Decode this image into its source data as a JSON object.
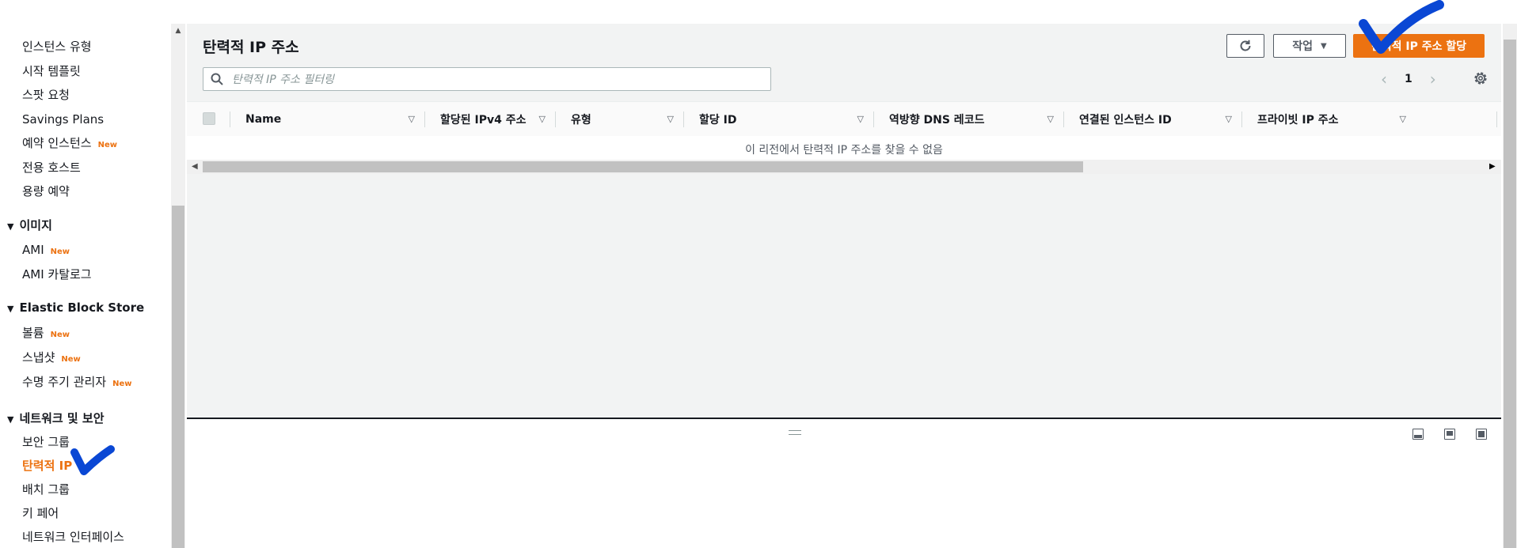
{
  "sidebar": {
    "items": [
      {
        "label": "인스턴스 유형"
      },
      {
        "label": "시작 템플릿"
      },
      {
        "label": "스팟 요청"
      },
      {
        "label": "Savings Plans"
      },
      {
        "label": "예약 인스턴스",
        "badge": "New"
      },
      {
        "label": "전용 호스트"
      },
      {
        "label": "용량 예약"
      }
    ],
    "sections": [
      {
        "title": "이미지",
        "items": [
          {
            "label": "AMI",
            "badge": "New"
          },
          {
            "label": "AMI 카탈로그"
          }
        ]
      },
      {
        "title": "Elastic Block Store",
        "items": [
          {
            "label": "볼륨",
            "badge": "New"
          },
          {
            "label": "스냅샷",
            "badge": "New"
          },
          {
            "label": "수명 주기 관리자",
            "badge": "New"
          }
        ]
      },
      {
        "title": "네트워크 및 보안",
        "items": [
          {
            "label": "보안 그룹"
          },
          {
            "label": "탄력적 IP",
            "active": true
          },
          {
            "label": "배치 그룹"
          },
          {
            "label": "키 페어"
          },
          {
            "label": "네트워크 인터페이스"
          }
        ]
      }
    ]
  },
  "main": {
    "title": "탄력적 IP 주소",
    "actions_label": "작업",
    "allocate_label": "탄력적 IP 주소 할당",
    "search_placeholder": "탄력적 IP 주소 필터링",
    "page_number": "1",
    "columns": [
      "Name",
      "할당된 IPv4 주소",
      "유형",
      "할당 ID",
      "역방향 DNS 레코드",
      "연결된 인스턴스 ID",
      "프라이빗 IP 주소"
    ],
    "empty_message": "이 리전에서 탄력적 IP 주소를 찾을 수 없음"
  },
  "colors": {
    "accent": "#ec7211",
    "annotation": "#0a47d4"
  }
}
